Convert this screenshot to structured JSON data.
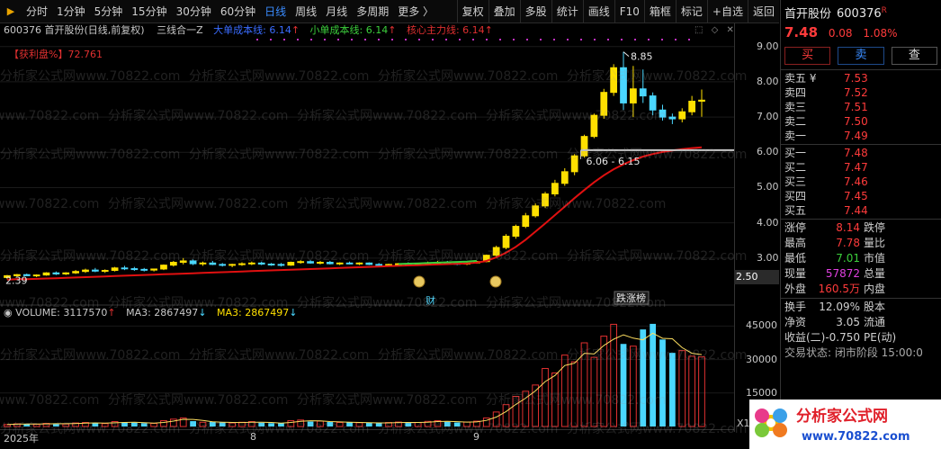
{
  "toolbar": {
    "periods": [
      "分时",
      "1分钟",
      "5分钟",
      "15分钟",
      "30分钟",
      "60分钟",
      "日线",
      "周线",
      "月线",
      "多周期",
      "更多 〉"
    ],
    "active_period": "日线",
    "tools": [
      "复权",
      "叠加",
      "多股",
      "统计",
      "画线",
      "F10",
      "箱框",
      "标记",
      "+自选",
      "返回"
    ]
  },
  "chart_header": {
    "title": "600376  首开股份(日线,前复权)",
    "indicator_name": "三线合一Z",
    "line_large": "大单成本线: 6.14",
    "line_small": "小单成本线: 6.14",
    "line_main": "核心主力线: 6.14",
    "profit_label": "【获利盘%】72.761"
  },
  "price_axis": {
    "ticks": [
      "9.00",
      "8.00",
      "7.00",
      "6.00",
      "5.00",
      "4.00",
      "3.00"
    ],
    "current": "2.50"
  },
  "annotations": {
    "high_label": "8.85",
    "range_label": "6.06 - 6.15",
    "low_label": "2.39",
    "event_cai": "财",
    "event_list": "跌涨榜"
  },
  "volume_header": {
    "volume": "VOLUME: 3117570",
    "ma3_a": "MA3: 2867497",
    "ma3_b": "MA3: 2867497"
  },
  "volume_axis": {
    "ticks": [
      "45000",
      "30000",
      "15000"
    ],
    "unit": "X10"
  },
  "date_axis": [
    "2025年",
    "8",
    "9"
  ],
  "watermark": "分析家公式网www.70822.com",
  "panel": {
    "name": "首开股份",
    "code": "600376",
    "r_mark": "R",
    "price": "7.48",
    "change": "0.08",
    "change_pct": "1.08%",
    "buttons": {
      "buy": "买",
      "sell": "卖",
      "query": "查"
    },
    "asks": [
      {
        "label": "卖五 ¥",
        "price": "7.53"
      },
      {
        "label": "卖四",
        "price": "7.52"
      },
      {
        "label": "卖三",
        "price": "7.51"
      },
      {
        "label": "卖二",
        "price": "7.50"
      },
      {
        "label": "卖一",
        "price": "7.49"
      }
    ],
    "bids": [
      {
        "label": "买一",
        "price": "7.48"
      },
      {
        "label": "买二",
        "price": "7.47"
      },
      {
        "label": "买三",
        "price": "7.46"
      },
      {
        "label": "买四",
        "price": "7.45"
      },
      {
        "label": "买五",
        "price": "7.44"
      }
    ],
    "stats": [
      {
        "l1": "涨停",
        "v1": "8.14",
        "l2": "跌停",
        "c": "red"
      },
      {
        "l1": "最高",
        "v1": "7.78",
        "l2": "量比",
        "c": "red"
      },
      {
        "l1": "最低",
        "v1": "7.01",
        "l2": "市值",
        "c": "green"
      },
      {
        "l1": "现量",
        "v1": "57872",
        "l2": "总量",
        "c": "magenta"
      },
      {
        "l1": "外盘",
        "v1": "160.5万",
        "l2": "内盘",
        "c": "red"
      }
    ],
    "stats2": [
      {
        "l1": "换手",
        "v1": "12.09%",
        "l2": "股本"
      },
      {
        "l1": "净资",
        "v1": "3.05",
        "l2": "流通"
      },
      {
        "l1": "收益(二)",
        "v1": "-0.750",
        "l2": "PE(动)"
      }
    ],
    "footer": "交易状态: 闭市阶段 15:00:0"
  },
  "logo": {
    "text": "分析家公式网",
    "url": "www.70822.com"
  },
  "chart_data": {
    "type": "candlestick",
    "ylim": [
      2.0,
      9.3
    ],
    "ohlc": [
      [
        2.45,
        2.52,
        2.4,
        2.5
      ],
      [
        2.5,
        2.55,
        2.47,
        2.53
      ],
      [
        2.53,
        2.56,
        2.49,
        2.5
      ],
      [
        2.5,
        2.54,
        2.46,
        2.52
      ],
      [
        2.52,
        2.6,
        2.5,
        2.58
      ],
      [
        2.58,
        2.62,
        2.52,
        2.55
      ],
      [
        2.55,
        2.6,
        2.52,
        2.58
      ],
      [
        2.58,
        2.66,
        2.55,
        2.62
      ],
      [
        2.62,
        2.7,
        2.58,
        2.66
      ],
      [
        2.66,
        2.72,
        2.6,
        2.63
      ],
      [
        2.63,
        2.68,
        2.58,
        2.65
      ],
      [
        2.65,
        2.75,
        2.62,
        2.72
      ],
      [
        2.72,
        2.78,
        2.66,
        2.7
      ],
      [
        2.7,
        2.75,
        2.64,
        2.68
      ],
      [
        2.68,
        2.72,
        2.62,
        2.66
      ],
      [
        2.66,
        2.7,
        2.62,
        2.69
      ],
      [
        2.69,
        2.82,
        2.66,
        2.8
      ],
      [
        2.8,
        2.92,
        2.76,
        2.88
      ],
      [
        2.88,
        3.0,
        2.82,
        2.92
      ],
      [
        2.92,
        2.96,
        2.8,
        2.84
      ],
      [
        2.84,
        2.9,
        2.78,
        2.86
      ],
      [
        2.86,
        2.92,
        2.8,
        2.82
      ],
      [
        2.82,
        2.86,
        2.76,
        2.8
      ],
      [
        2.8,
        2.84,
        2.74,
        2.82
      ],
      [
        2.82,
        2.88,
        2.78,
        2.84
      ],
      [
        2.84,
        2.9,
        2.8,
        2.86
      ],
      [
        2.86,
        2.9,
        2.8,
        2.83
      ],
      [
        2.83,
        2.86,
        2.78,
        2.82
      ],
      [
        2.82,
        2.86,
        2.76,
        2.8
      ],
      [
        2.8,
        2.9,
        2.78,
        2.88
      ],
      [
        2.88,
        2.94,
        2.84,
        2.9
      ],
      [
        2.9,
        2.94,
        2.84,
        2.86
      ],
      [
        2.86,
        2.92,
        2.82,
        2.88
      ],
      [
        2.88,
        2.92,
        2.82,
        2.84
      ],
      [
        2.84,
        2.88,
        2.8,
        2.86
      ],
      [
        2.86,
        2.9,
        2.82,
        2.84
      ],
      [
        2.84,
        2.88,
        2.8,
        2.86
      ],
      [
        2.86,
        2.88,
        2.8,
        2.82
      ],
      [
        2.82,
        2.86,
        2.78,
        2.8
      ],
      [
        2.8,
        2.84,
        2.76,
        2.82
      ],
      [
        2.82,
        2.86,
        2.78,
        2.84
      ],
      [
        2.84,
        2.88,
        2.8,
        2.82
      ],
      [
        2.82,
        2.86,
        2.78,
        2.84
      ],
      [
        2.84,
        2.9,
        2.8,
        2.86
      ],
      [
        2.86,
        2.92,
        2.82,
        2.88
      ],
      [
        2.88,
        2.92,
        2.82,
        2.85
      ],
      [
        2.85,
        2.9,
        2.8,
        2.83
      ],
      [
        2.83,
        2.88,
        2.8,
        2.86
      ],
      [
        2.86,
        2.92,
        2.84,
        2.9
      ],
      [
        2.9,
        3.1,
        2.88,
        3.08
      ],
      [
        3.08,
        3.35,
        3.05,
        3.3
      ],
      [
        3.3,
        3.68,
        3.25,
        3.62
      ],
      [
        3.62,
        3.95,
        3.55,
        3.9
      ],
      [
        3.9,
        4.28,
        3.85,
        4.2
      ],
      [
        4.2,
        4.55,
        4.15,
        4.48
      ],
      [
        4.48,
        4.88,
        4.42,
        4.82
      ],
      [
        4.82,
        5.22,
        4.75,
        5.12
      ],
      [
        5.12,
        5.55,
        5.05,
        5.45
      ],
      [
        5.45,
        5.95,
        5.35,
        5.9
      ],
      [
        5.9,
        6.5,
        5.85,
        6.45
      ],
      [
        6.45,
        7.1,
        6.4,
        7.05
      ],
      [
        7.05,
        7.8,
        6.95,
        7.7
      ],
      [
        7.7,
        8.5,
        7.6,
        8.4
      ],
      [
        8.4,
        8.85,
        7.2,
        7.4
      ],
      [
        7.4,
        8.45,
        7.0,
        7.8
      ],
      [
        7.8,
        8.35,
        7.4,
        7.6
      ],
      [
        7.6,
        7.7,
        7.05,
        7.2
      ],
      [
        7.2,
        7.35,
        6.9,
        7.0
      ],
      [
        7.0,
        7.1,
        6.8,
        6.95
      ],
      [
        6.95,
        7.25,
        6.85,
        7.15
      ],
      [
        7.15,
        7.6,
        7.05,
        7.45
      ],
      [
        7.45,
        7.78,
        7.01,
        7.48
      ]
    ],
    "main_line": [
      2.39,
      2.4,
      2.4,
      2.41,
      2.42,
      2.43,
      2.44,
      2.45,
      2.46,
      2.47,
      2.48,
      2.49,
      2.5,
      2.51,
      2.52,
      2.53,
      2.54,
      2.55,
      2.56,
      2.57,
      2.58,
      2.59,
      2.6,
      2.61,
      2.62,
      2.63,
      2.64,
      2.65,
      2.66,
      2.67,
      2.68,
      2.69,
      2.7,
      2.71,
      2.72,
      2.73,
      2.74,
      2.75,
      2.76,
      2.77,
      2.78,
      2.79,
      2.8,
      2.81,
      2.82,
      2.83,
      2.84,
      2.85,
      2.87,
      2.92,
      3.02,
      3.15,
      3.32,
      3.52,
      3.75,
      3.98,
      4.22,
      4.46,
      4.7,
      4.93,
      5.15,
      5.35,
      5.52,
      5.66,
      5.78,
      5.88,
      5.95,
      6.01,
      6.05,
      6.09,
      6.12,
      6.14
    ],
    "volume": [
      900,
      1200,
      1100,
      1000,
      1400,
      1300,
      1100,
      1600,
      1800,
      1500,
      1300,
      2200,
      1900,
      1700,
      1500,
      1400,
      2600,
      3300,
      3800,
      2400,
      1900,
      2100,
      1800,
      1600,
      1900,
      2200,
      1700,
      1500,
      1400,
      2600,
      2900,
      2200,
      2400,
      2000,
      1800,
      1900,
      1700,
      1600,
      1500,
      1800,
      2000,
      1600,
      1800,
      2300,
      2600,
      2100,
      1800,
      2000,
      2400,
      3800,
      6500,
      9800,
      13500,
      15800,
      18600,
      26000,
      24000,
      32000,
      29000,
      37500,
      31000,
      40500,
      45800,
      37000,
      36000,
      43500,
      46000,
      39000,
      33000,
      34000,
      31500,
      31178
    ],
    "vol_ma3": [
      900,
      1050,
      1070,
      1100,
      1170,
      1230,
      1270,
      1330,
      1500,
      1630,
      1530,
      1670,
      1800,
      1930,
      1700,
      1530,
      1830,
      2430,
      3230,
      3170,
      2700,
      2130,
      1930,
      1830,
      1770,
      1900,
      1930,
      1800,
      1530,
      1830,
      2300,
      2570,
      2500,
      2200,
      2070,
      1900,
      1800,
      1730,
      1600,
      1630,
      1770,
      1800,
      1800,
      1900,
      2230,
      2330,
      2170,
      1970,
      2070,
      2730,
      4230,
      6700,
      9930,
      12700,
      15970,
      20130,
      22870,
      27330,
      28330,
      32830,
      32500,
      36330,
      39100,
      41100,
      39600,
      38830,
      41830,
      39500,
      39330,
      35330,
      32830,
      32226
    ],
    "vol_ylim": [
      0,
      50000
    ]
  }
}
